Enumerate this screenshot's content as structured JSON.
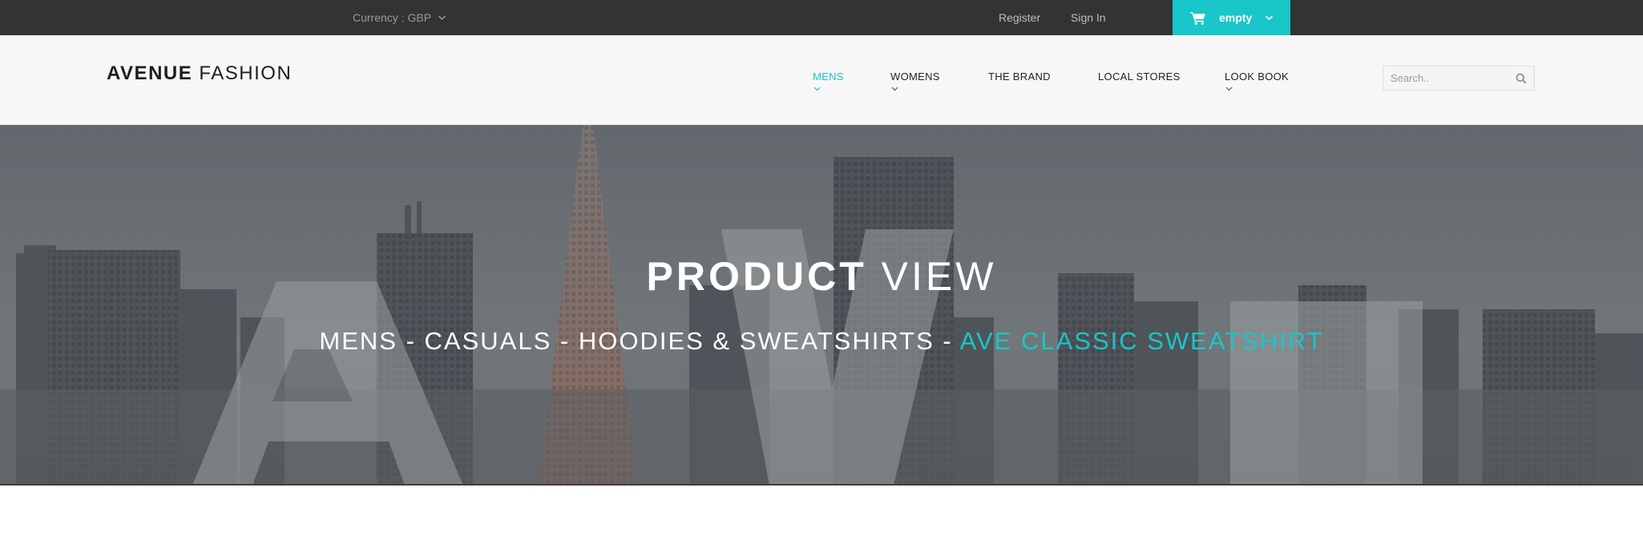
{
  "topbar": {
    "currency_label": "Currency : GBP",
    "register": "Register",
    "sign_in": "Sign In",
    "cart_label": "empty",
    "cart_icon": "shopping-cart-icon",
    "background": "#333333",
    "accent": "#19c6c9"
  },
  "header": {
    "logo_bold": "AVENUE",
    "logo_light": "FASHION",
    "nav": [
      {
        "label": "MENS",
        "active": true,
        "has_submenu": true
      },
      {
        "label": "WOMENS",
        "active": false,
        "has_submenu": true
      },
      {
        "label": "THE BRAND",
        "active": false,
        "has_submenu": false
      },
      {
        "label": "LOCAL STORES",
        "active": false,
        "has_submenu": false
      },
      {
        "label": "LOOK BOOK",
        "active": false,
        "has_submenu": true
      }
    ],
    "search_placeholder": "Search..",
    "search_icon": "search-icon"
  },
  "hero": {
    "title_bold": "PRODUCT",
    "title_light": "VIEW",
    "breadcrumb": [
      "MENS",
      "CASUALS",
      "HOODIES & SWEATSHIRTS",
      "AVE CLASSIC SWEATSHIRT"
    ],
    "separator": " - ",
    "background_watermark": "AVE"
  }
}
